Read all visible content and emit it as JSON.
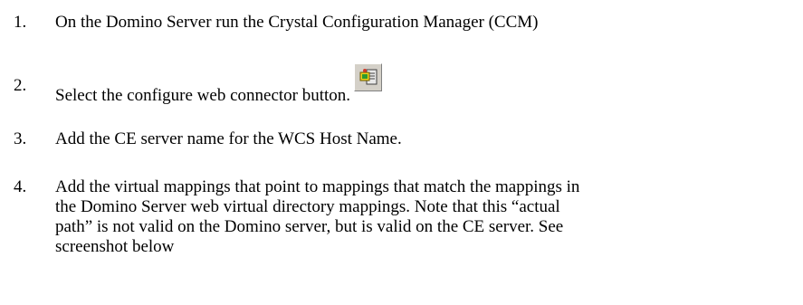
{
  "steps": [
    {
      "number": "1.",
      "text": "On the Domino Server run the Crystal Configuration Manager (CCM)"
    },
    {
      "number": "2.",
      "text": "Select the configure web connector button.",
      "icon": "configure-web-connector-icon"
    },
    {
      "number": "3.",
      "text": "Add the CE server name for the WCS Host Name."
    },
    {
      "number": "4.",
      "lines": [
        "Add the virtual mappings that point to mappings that match the mappings in",
        "the Domino Server web virtual directory mappings. Note that this “actual",
        "path” is not valid on the Domino server, but is valid on the CE server. See",
        "screenshot below"
      ]
    }
  ]
}
